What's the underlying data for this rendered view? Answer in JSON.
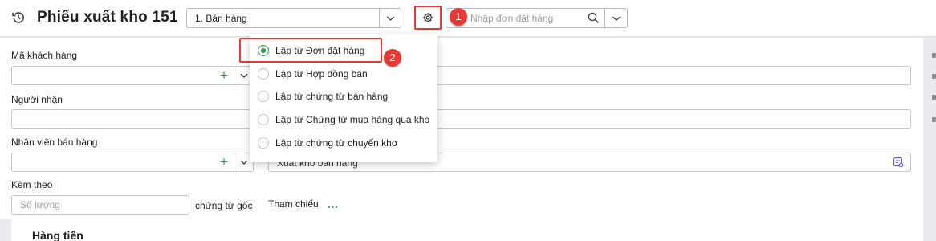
{
  "header": {
    "title": "Phiếu xuất kho 151",
    "type_value": "1. Bán hàng",
    "search_placeholder": "Nhập đơn đặt hàng"
  },
  "annotations": {
    "step1": "1",
    "step2": "2"
  },
  "form": {
    "customer_code_label": "Mã khách hàng",
    "recipient_label": "Người nhận",
    "salesperson_label": "Nhân viên bán hàng",
    "reason_value": "Xuất kho bán hàng",
    "attach_label": "Kèm theo",
    "quantity_placeholder": "Số lượng",
    "original_docs_label": "chứng từ gốc",
    "reference_label": "Tham chiếu",
    "reference_more": "..."
  },
  "source_menu": {
    "options": [
      {
        "label": "Lập từ Đơn đặt hàng",
        "selected": true
      },
      {
        "label": "Lập từ Hợp đồng bán",
        "selected": false
      },
      {
        "label": "Lập từ chứng từ bán hàng",
        "selected": false
      },
      {
        "label": "Lập từ Chứng từ mua hàng qua kho",
        "selected": false
      },
      {
        "label": "Lập từ chứng từ chuyển kho",
        "selected": false
      }
    ]
  },
  "section": {
    "title": "Hàng tiền"
  },
  "colors": {
    "accent_green": "#2e9a48",
    "highlight_red": "#e53935"
  },
  "icons": [
    "history-icon",
    "chevron-down-icon",
    "gear-icon",
    "search-icon",
    "plus-icon",
    "memo-icon"
  ]
}
